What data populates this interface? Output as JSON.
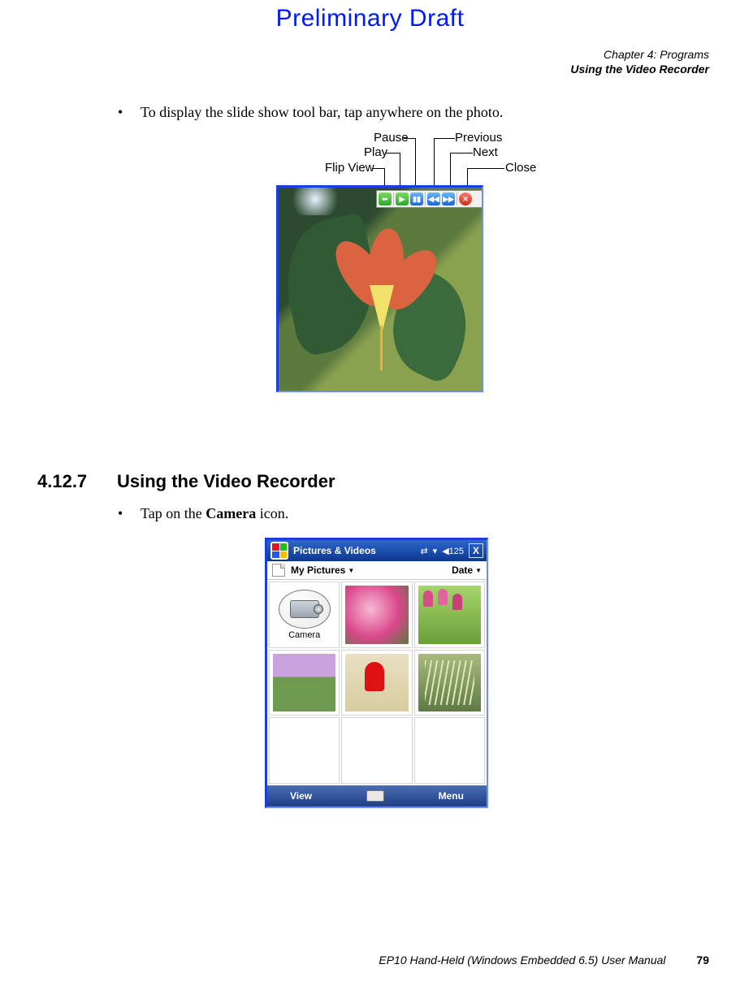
{
  "header": {
    "draft": "Preliminary Draft"
  },
  "chapter": {
    "line1": "Chapter 4: Programs",
    "line2": "Using the Video Recorder"
  },
  "bullets": {
    "b1_prefix": "•",
    "b1": "To display the slide show tool bar, tap anywhere on the photo.",
    "b2_prefix": "•",
    "b2_a": "Tap on the ",
    "b2_b": "Camera",
    "b2_c": " icon."
  },
  "callouts": {
    "flip_view": "Flip View",
    "play": "Play",
    "pause": "Pause",
    "previous": "Previous",
    "next": "Next",
    "close": "Close"
  },
  "section": {
    "num": "4.12.7",
    "title": "Using the Video Recorder"
  },
  "window": {
    "title": "Pictures & Videos",
    "folder": "My Pictures",
    "sort": "Date",
    "camera_label": "Camera",
    "view": "View",
    "menu": "Menu",
    "close_glyph": "X"
  },
  "footer": {
    "text": "EP10 Hand-Held (Windows Embedded 6.5) User Manual",
    "page": "79"
  }
}
